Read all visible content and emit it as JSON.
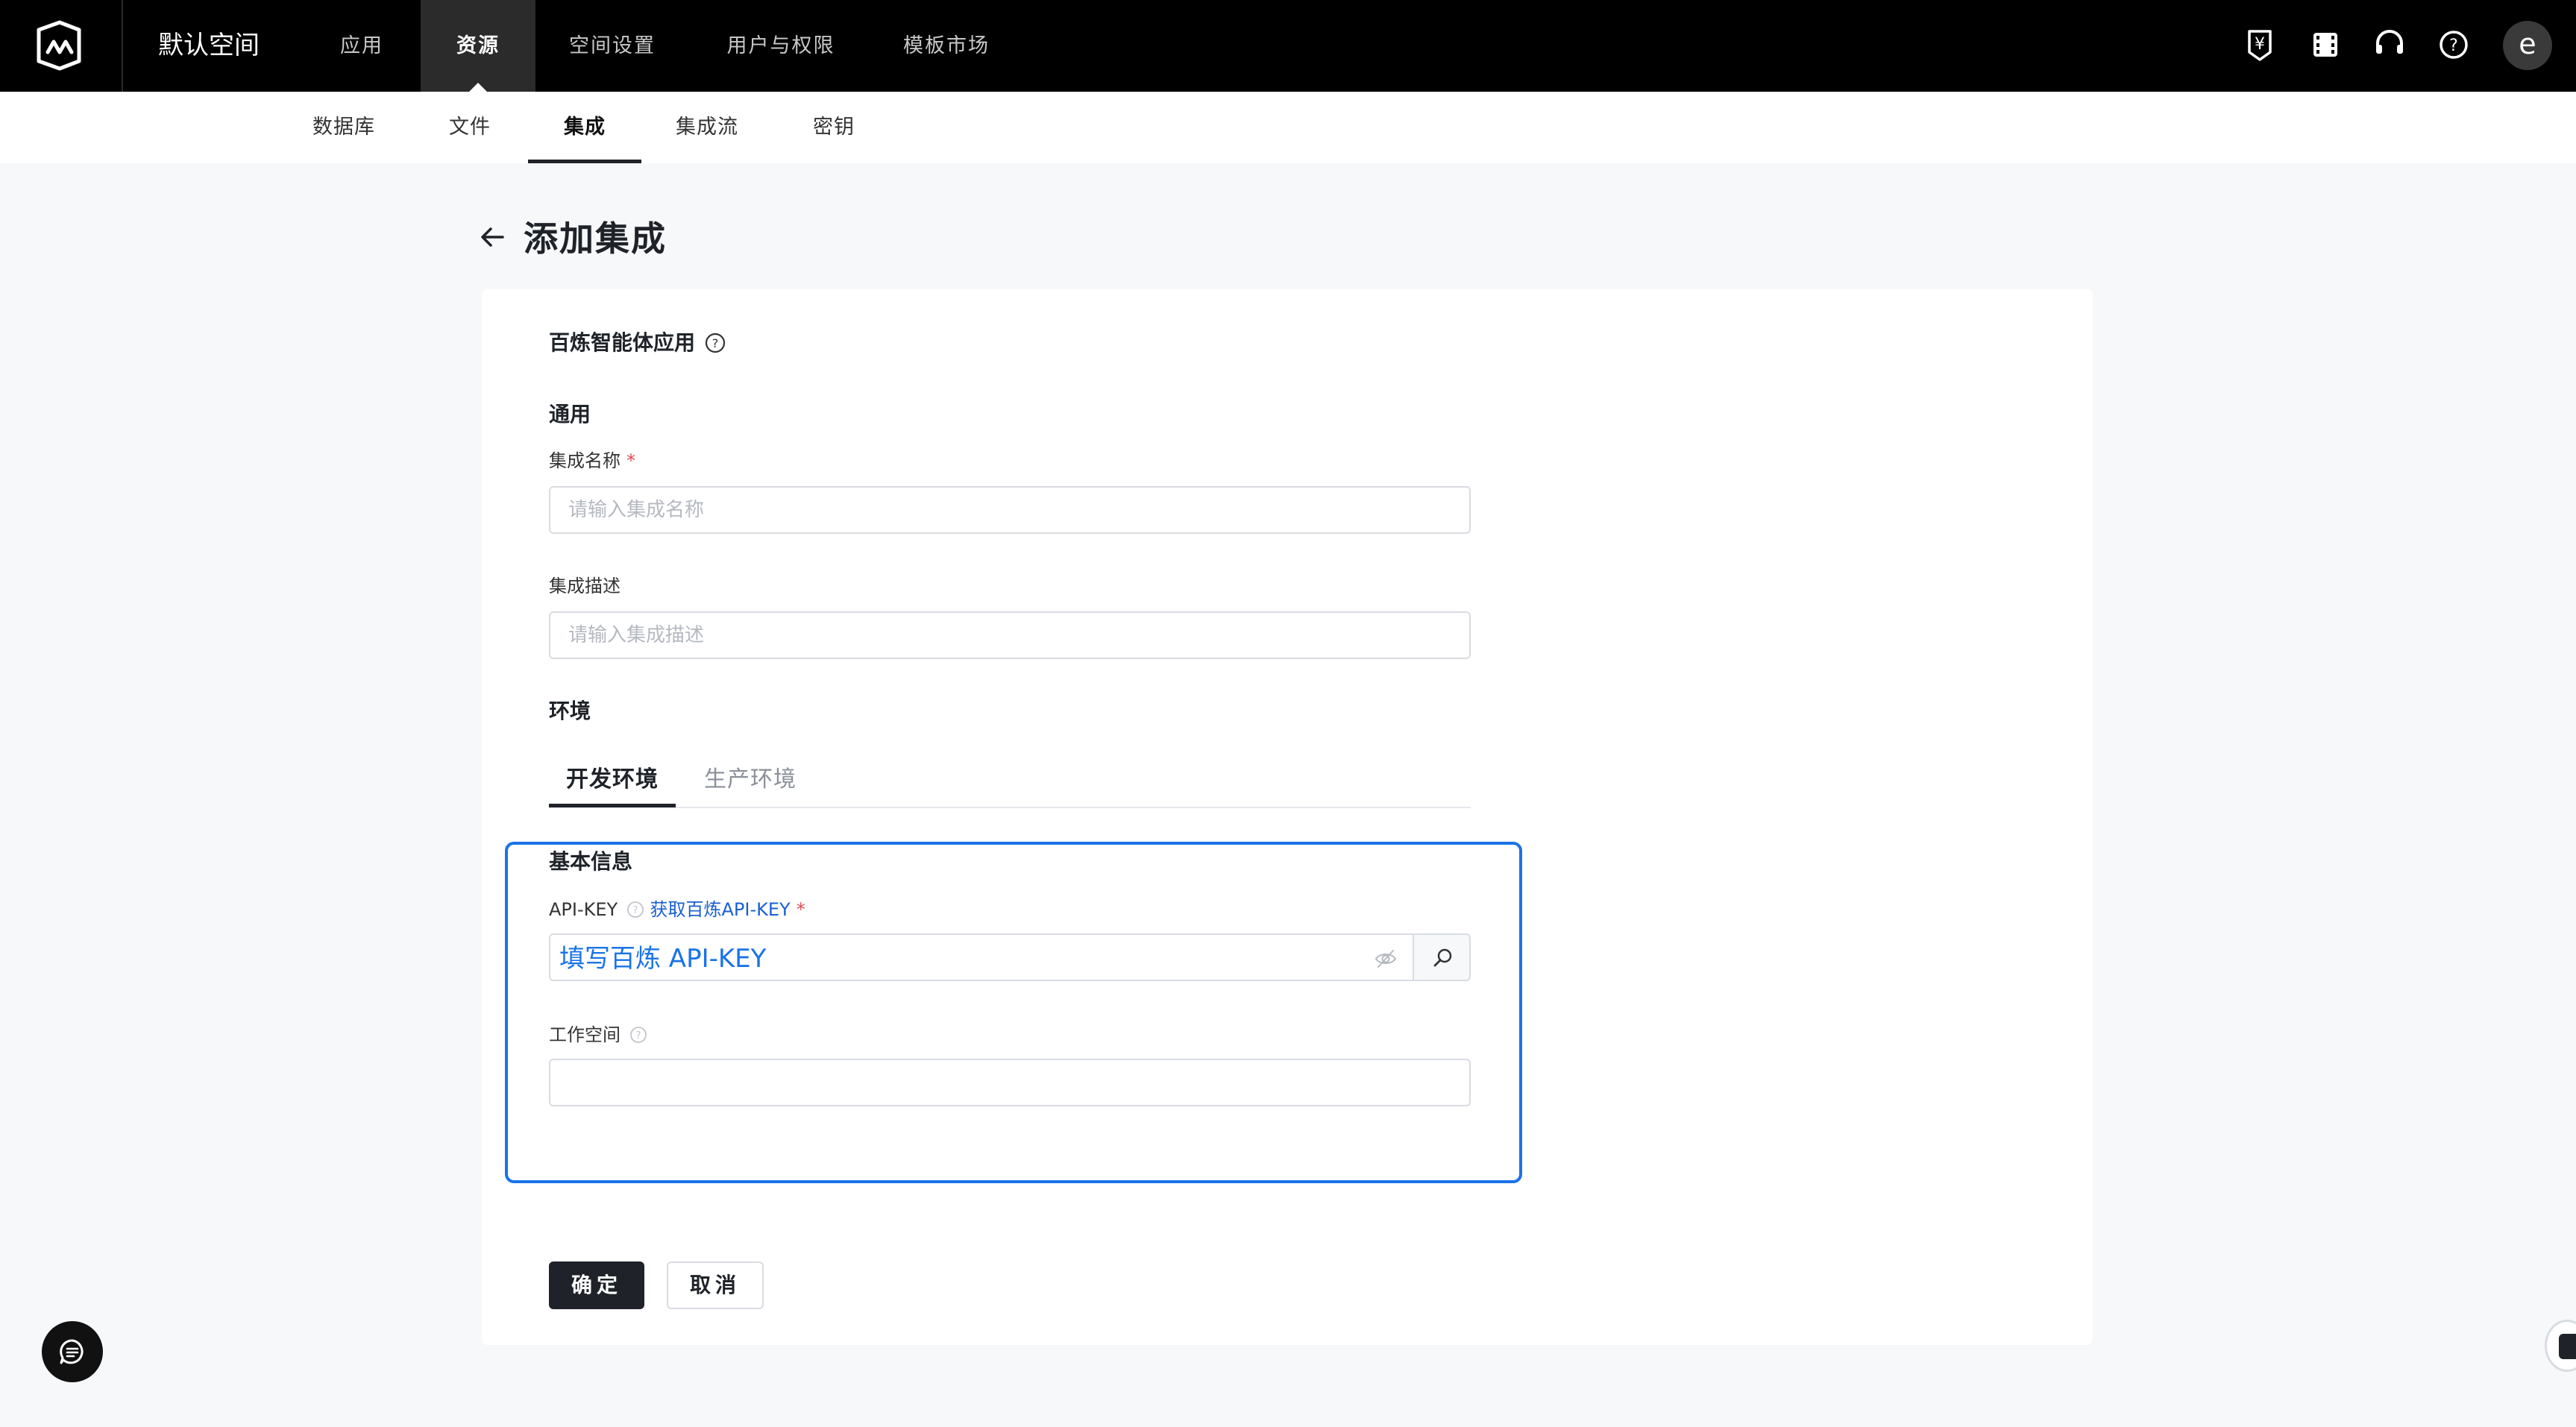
{
  "topbar": {
    "space_name": "默认空间",
    "nav": [
      {
        "label": "应用",
        "active": false
      },
      {
        "label": "资源",
        "active": true
      },
      {
        "label": "空间设置",
        "active": false
      },
      {
        "label": "用户与权限",
        "active": false
      },
      {
        "label": "模板市场",
        "active": false
      }
    ],
    "icons": [
      "billing-icon",
      "video-tutorial-icon",
      "support-headset-icon",
      "help-icon"
    ],
    "avatar_letter": "e"
  },
  "subnav": {
    "items": [
      {
        "label": "数据库",
        "active": false
      },
      {
        "label": "文件",
        "active": false
      },
      {
        "label": "集成",
        "active": true
      },
      {
        "label": "集成流",
        "active": false
      },
      {
        "label": "密钥",
        "active": false
      }
    ]
  },
  "page": {
    "title": "添加集成"
  },
  "form": {
    "integration_type": "百炼智能体应用",
    "general_title": "通用",
    "name_label": "集成名称",
    "required_mark": "*",
    "name_placeholder": "请输入集成名称",
    "desc_label": "集成描述",
    "desc_placeholder": "请输入集成描述",
    "env_title": "环境",
    "env_tabs": [
      {
        "label": "开发环境",
        "active": true
      },
      {
        "label": "生产环境",
        "active": false
      }
    ],
    "basic_info_title": "基本信息",
    "api_key_label": "API-KEY",
    "api_key_link": "获取百炼API-KEY",
    "api_key_placeholder": "填写百炼 API-KEY",
    "workspace_label": "工作空间",
    "workspace_value": "",
    "confirm_label": "确定",
    "cancel_label": "取消"
  },
  "colors": {
    "topbar_bg": "#000000",
    "primary_button": "#1f2329",
    "highlight_border": "#1a73e8",
    "link": "#1a5fd1",
    "required": "#e34d59"
  }
}
